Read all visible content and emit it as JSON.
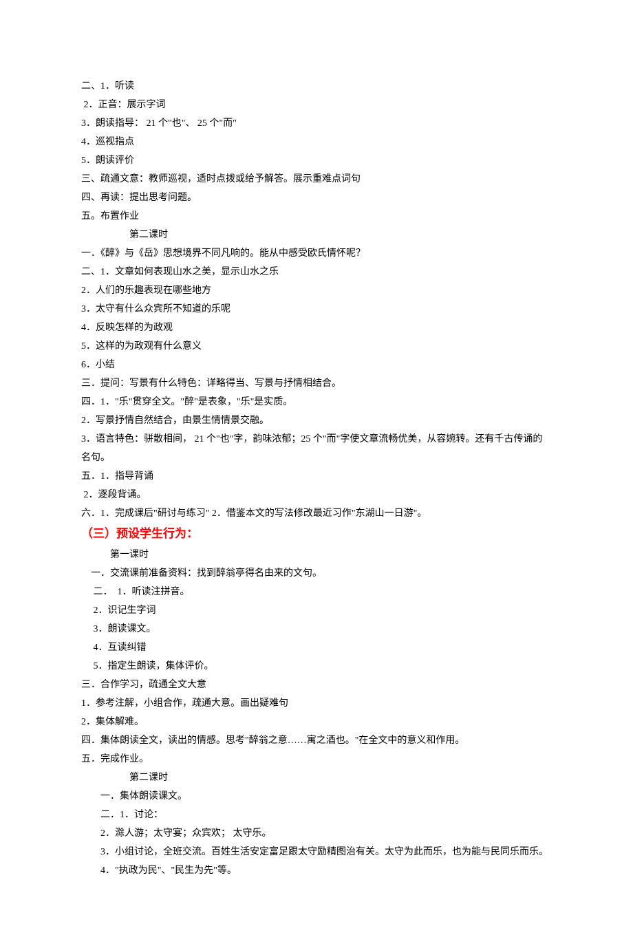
{
  "lines": [
    {
      "text": "二、1．听读",
      "indent": 0
    },
    {
      "text": " 2．正音：展示字词",
      "indent": 0
    },
    {
      "text": "3．朗读指导： 21 个\"也\"、 25 个\"而\"",
      "indent": 0
    },
    {
      "text": "4．巡视指点",
      "indent": 0
    },
    {
      "text": "5．朗读评价",
      "indent": 0
    },
    {
      "text": "三、疏通文意：教师巡视，适时点拨或给予解答。展示重难点词句",
      "indent": 0
    },
    {
      "text": "四、再读：提出思考问题。",
      "indent": 0
    },
    {
      "text": "五。布置作业",
      "indent": 0
    },
    {
      "text": "第二课时",
      "indent": 4
    },
    {
      "text": "一．《醉》与《岳》思想境界不同凡响的。能从中感受欧氏情怀呢？",
      "indent": 0
    },
    {
      "text": "二、1．文章如何表现山水之美，显示山水之乐",
      "indent": 0
    },
    {
      "text": "2．人们的乐趣表现在哪些地方",
      "indent": 0
    },
    {
      "text": "3．太守有什么众宾所不知道的乐呢",
      "indent": 0
    },
    {
      "text": "4．反映怎样的为政观",
      "indent": 0
    },
    {
      "text": "5．这样的为政观有什么意义",
      "indent": 0
    },
    {
      "text": "6．小结",
      "indent": 0
    },
    {
      "text": "三．提问：写景有什么特色：详略得当、写景与抒情相结合。",
      "indent": 0
    },
    {
      "text": "四．1．\"乐\"贯穿全文。\"醉\"是表象，\"乐\"是实质。",
      "indent": 0
    },
    {
      "text": "2．写景抒情自然结合，由景生情情景交融。",
      "indent": 0
    },
    {
      "text": "3．语言特色：骈散相间， 21 个\"也\"字，韵味浓郁；25 个\"而\"字使文章流畅优美，从容婉转。还有千古传诵的名句。",
      "indent": 0
    },
    {
      "text": "五．1．指导背诵",
      "indent": 0
    },
    {
      "text": " 2．逐段背诵。",
      "indent": 0
    },
    {
      "text": "六．1．完成课后\"研讨与练习\" 2．借鉴本文的写法修改最近习作\"东湖山一日游\"。",
      "indent": 0
    },
    {
      "text": "（三）预设学生行为：",
      "indent": 0,
      "red": true
    },
    {
      "text": "第一课时",
      "indent": 3
    },
    {
      "text": "一．交流课前准备资料：找到醉翁亭得名由来的文句。",
      "indent": 1
    },
    {
      "text": " 二．  1．听读注拼音。",
      "indent": 1
    },
    {
      "text": " 2．识记生字词",
      "indent": 1
    },
    {
      "text": " 3．朗读课文。",
      "indent": 1
    },
    {
      "text": " 4．互读纠错",
      "indent": 1
    },
    {
      "text": " 5．指定生朗读，集体评价。",
      "indent": 1
    },
    {
      "text": "三．合作学习，疏通全文大意",
      "indent": 0
    },
    {
      "text": "1．参考注解，小组合作，疏通大意。画出疑难句",
      "indent": 0
    },
    {
      "text": "2．集体解难。",
      "indent": 0
    },
    {
      "text": "四．集体朗读全文，读出的情感。思考\"醉翁之意……寓之酒也。\"在全文中的意义和作用。",
      "indent": 0
    },
    {
      "text": "五．完成作业。",
      "indent": 0
    },
    {
      "text": "第二课时",
      "indent": 4
    },
    {
      "text": "一．集体朗读课文。",
      "indent": 2
    },
    {
      "text": "二．1．讨论：",
      "indent": 2
    },
    {
      "text": "2．滁人游；太守宴；众宾欢； 太守乐。",
      "indent": 2
    },
    {
      "text": "3．小组讨论，全班交流。百姓生活安定富足跟太守励精图治有关。太守为此而乐，也为能与民同乐而乐。",
      "indent": 2
    },
    {
      "text": "4．\"执政为民\"、\"民生为先\"等。",
      "indent": 2
    }
  ]
}
